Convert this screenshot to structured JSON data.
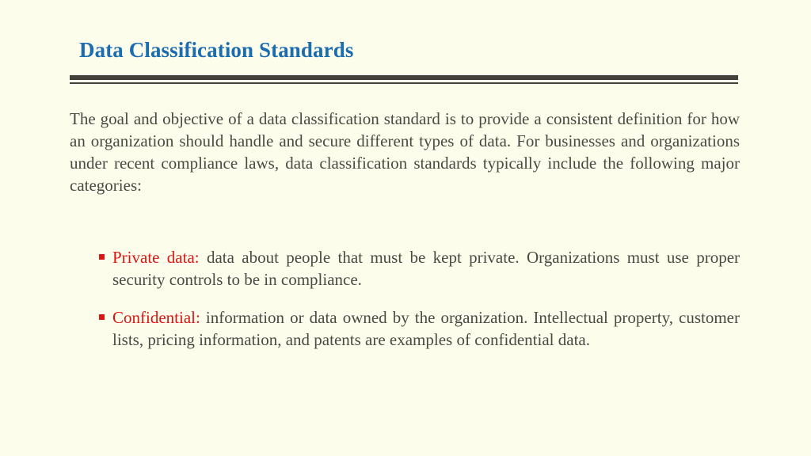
{
  "slide": {
    "background_color": "#fdfdec",
    "title": "Data Classification Standards",
    "title_color": "#1c6cb0",
    "divider_color": "#44413a",
    "body_text_color": "#4a4a44",
    "accent_color": "#dd1414",
    "intro_paragraph": "The goal and objective of a data classification standard is to provide a consistent definition for how an organization should handle and secure different types of data. For businesses and organizations under recent compliance laws, data classification standards typically include the following major categories:",
    "bullets": [
      {
        "marker": "square-bullet-icon",
        "term": "Private data:",
        "text": " data about people that must be kept private. Organizations must use proper security controls to be in compliance."
      },
      {
        "marker": "square-bullet-icon",
        "term": "Confidential:",
        "text": " information or data owned by the organization. Intellectual property, customer lists, pricing information, and patents are examples of confidential data."
      }
    ]
  }
}
